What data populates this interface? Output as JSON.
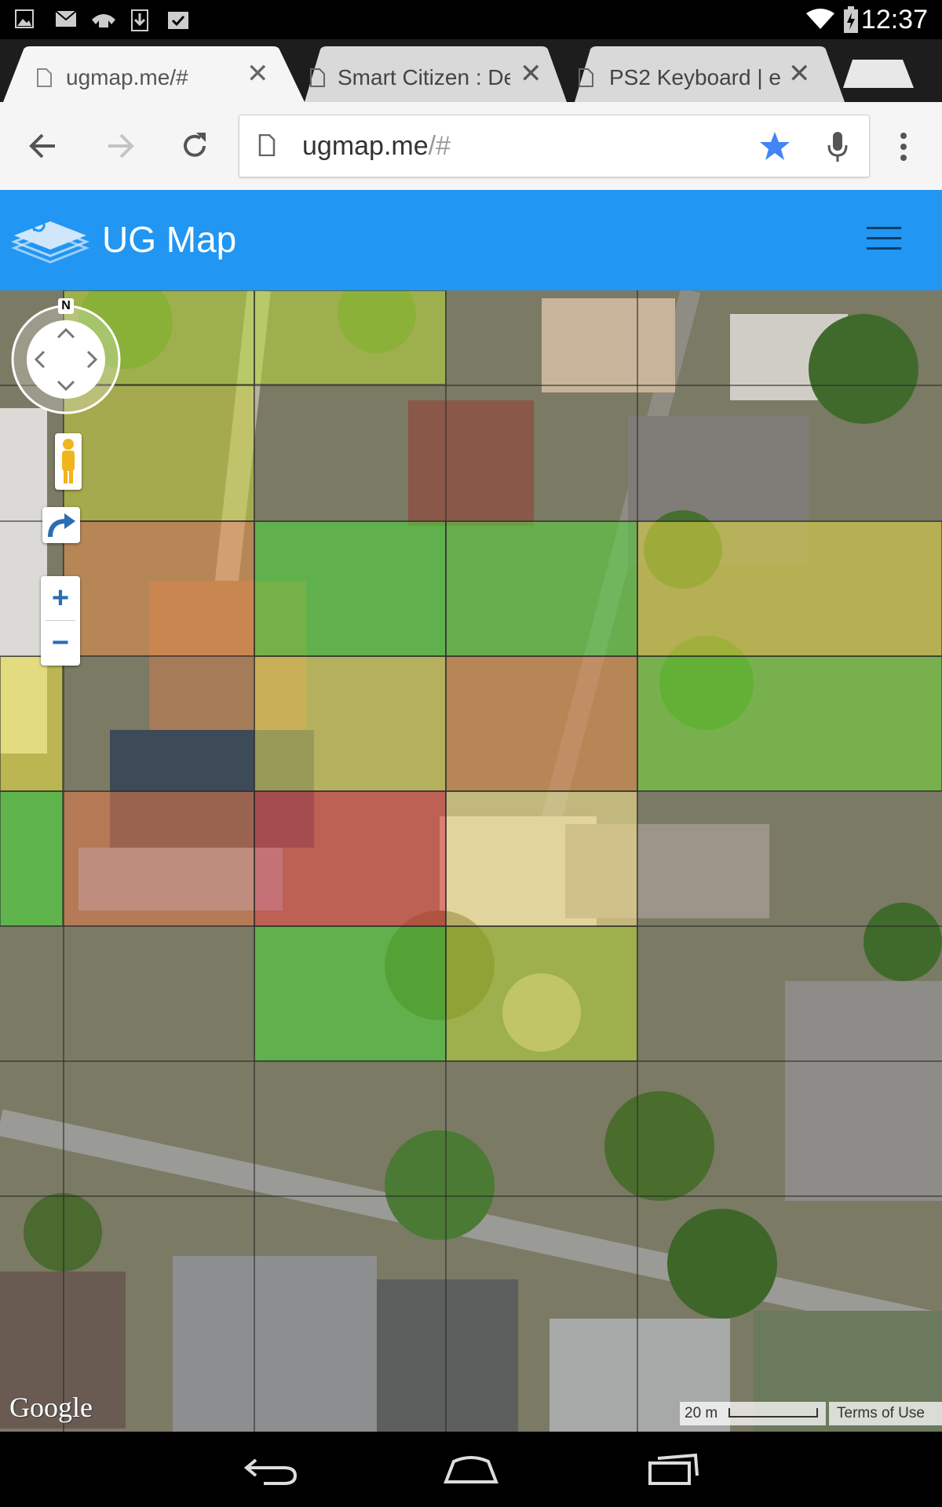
{
  "status_bar": {
    "time": "12:37",
    "icons": [
      "image-icon",
      "mail-icon",
      "voicemail-icon",
      "download-icon",
      "clipboard-check-icon",
      "wifi-icon",
      "battery-charging-icon"
    ]
  },
  "tabs": [
    {
      "title": "ugmap.me/#",
      "active": true
    },
    {
      "title": "Smart Citizen : De",
      "active": false
    },
    {
      "title": "PS2 Keyboard | e",
      "active": false
    }
  ],
  "toolbar": {
    "url_host": "ugmap.me",
    "url_path": "/#"
  },
  "app": {
    "title": "UG Map",
    "brand_color": "#2196f3"
  },
  "map": {
    "compass_label": "N",
    "zoom_in_label": "+",
    "zoom_out_label": "−",
    "logo_text": "Google",
    "scale_label": "20 m",
    "terms_label": "Terms of Use",
    "overlay_colors": {
      "green": "#4cdc3c",
      "yellow_green": "#b9dc3a",
      "yellow": "#e6dc46",
      "light_yellow": "#f2e08c",
      "orange": "#e8904a",
      "red": "#e8504a"
    },
    "rows": [
      [
        "none",
        "yellow_green",
        "yellow_green",
        "none",
        "none"
      ],
      [
        "none",
        "yellow_green",
        "none",
        "none",
        "none"
      ],
      [
        "none",
        "orange",
        "green",
        "green",
        "yellow"
      ],
      [
        "yellow",
        "none",
        "yellow",
        "orange",
        "green"
      ],
      [
        "green",
        "orange",
        "red",
        "light_yellow",
        "none"
      ],
      [
        "none",
        "none",
        "green",
        "yellow_green",
        "none"
      ],
      [
        "none",
        "none",
        "none",
        "none",
        "none"
      ]
    ]
  }
}
